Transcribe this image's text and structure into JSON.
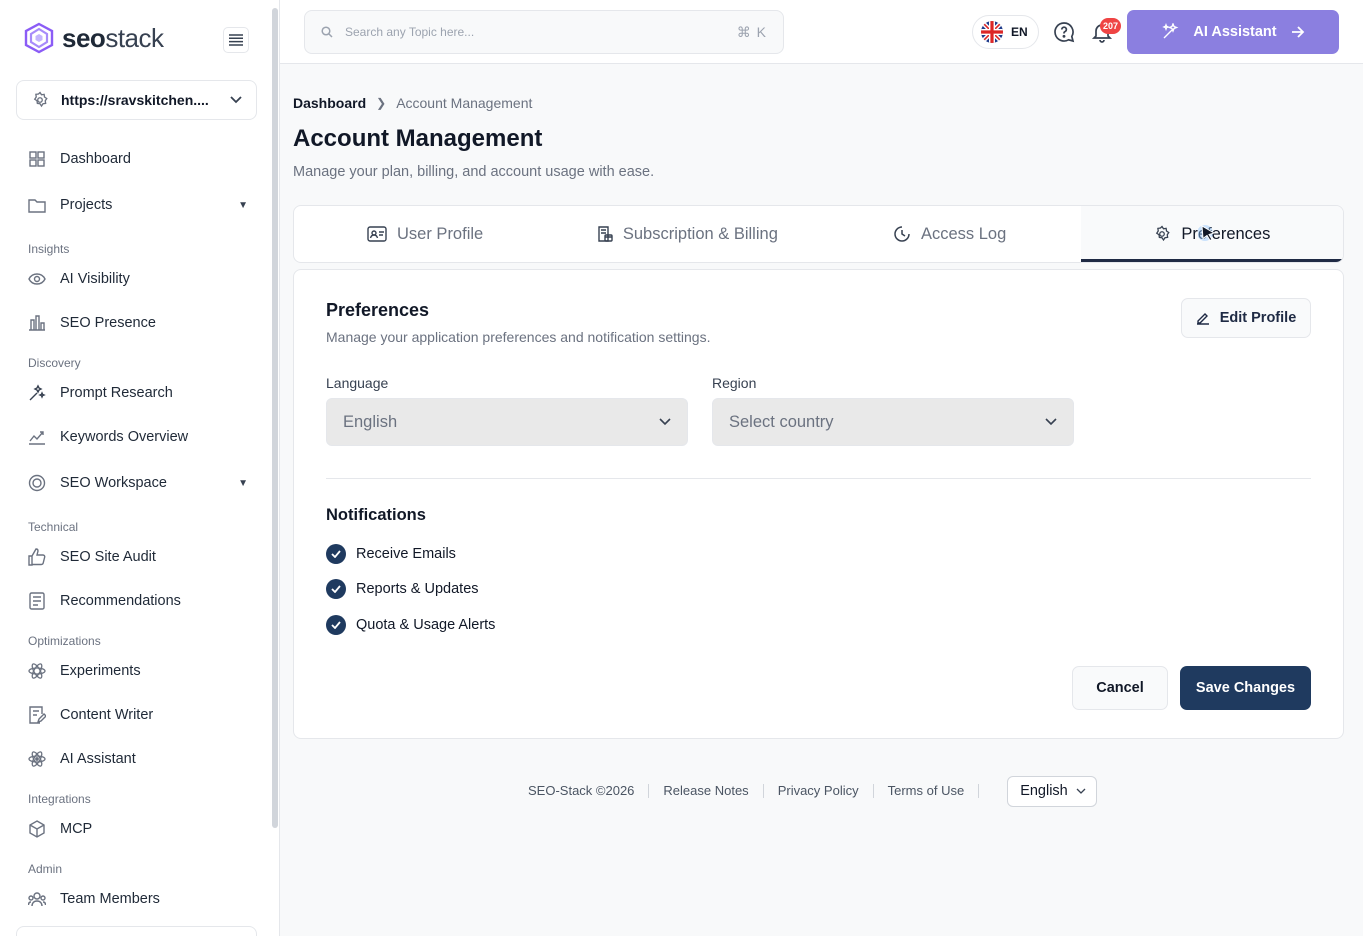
{
  "brand": {
    "name_bold": "seo",
    "name_light": "stack"
  },
  "sidebar": {
    "site": "https://sravskitchen....",
    "items": [
      {
        "label": "Dashboard"
      },
      {
        "label": "Projects"
      },
      {
        "group": "Insights"
      },
      {
        "label": "AI Visibility"
      },
      {
        "label": "SEO Presence"
      },
      {
        "group": "Discovery"
      },
      {
        "label": "Prompt Research"
      },
      {
        "label": "Keywords Overview"
      },
      {
        "label": "SEO Workspace"
      },
      {
        "group": "Technical"
      },
      {
        "label": "SEO Site Audit"
      },
      {
        "label": "Recommendations"
      },
      {
        "group": "Optimizations"
      },
      {
        "label": "Experiments"
      },
      {
        "label": "Content Writer"
      },
      {
        "label": "AI Assistant"
      },
      {
        "group": "Integrations"
      },
      {
        "label": "MCP"
      },
      {
        "group": "Admin"
      },
      {
        "label": "Team Members"
      }
    ]
  },
  "topbar": {
    "search_placeholder": "Search any Topic here...",
    "shortcut": "⌘ K",
    "lang_code": "EN",
    "notif_count": "207",
    "ai_button": "AI Assistant"
  },
  "breadcrumb": {
    "root": "Dashboard",
    "current": "Account Management"
  },
  "page": {
    "title": "Account Management",
    "subtitle": "Manage your plan, billing, and account usage with ease."
  },
  "tabs": [
    {
      "label": "User Profile"
    },
    {
      "label": "Subscription & Billing"
    },
    {
      "label": "Access Log"
    },
    {
      "label": "Preferences"
    }
  ],
  "preferences": {
    "title": "Preferences",
    "subtitle": "Manage your application preferences and notification settings.",
    "edit_button": "Edit Profile",
    "language_label": "Language",
    "language_value": "English",
    "region_label": "Region",
    "region_placeholder": "Select country",
    "notifications_title": "Notifications",
    "notifications": [
      {
        "label": "Receive Emails",
        "checked": true
      },
      {
        "label": "Reports & Updates",
        "checked": true
      },
      {
        "label": "Quota & Usage Alerts",
        "checked": true
      }
    ],
    "cancel_button": "Cancel",
    "save_button": "Save Changes"
  },
  "footer": {
    "copyright": "SEO-Stack ©2026",
    "links": [
      "Release Notes",
      "Privacy Policy",
      "Terms of Use"
    ],
    "language": "English"
  },
  "colors": {
    "accent": "#8b7fe0",
    "primary": "#1f3a5f",
    "badge": "#ef4444"
  }
}
